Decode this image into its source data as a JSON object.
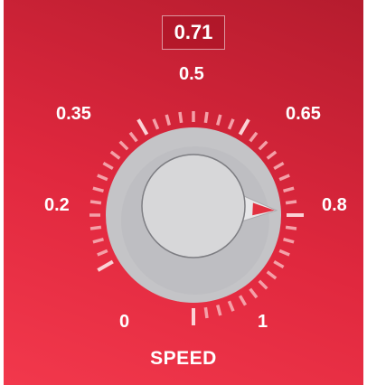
{
  "knob": {
    "value_display": "0.71",
    "value": 0.71,
    "min": 0,
    "max": 1,
    "label": "SPEED",
    "scale_labels": [
      "0",
      "0.2",
      "0.35",
      "0.5",
      "0.65",
      "0.8",
      "1"
    ]
  },
  "colors": {
    "background": "#e02a3f",
    "knob_face": "#d6d6d8",
    "knob_ring": "#c3c3c6",
    "pointer": "#e23040",
    "tick": "#f4a0a8"
  }
}
